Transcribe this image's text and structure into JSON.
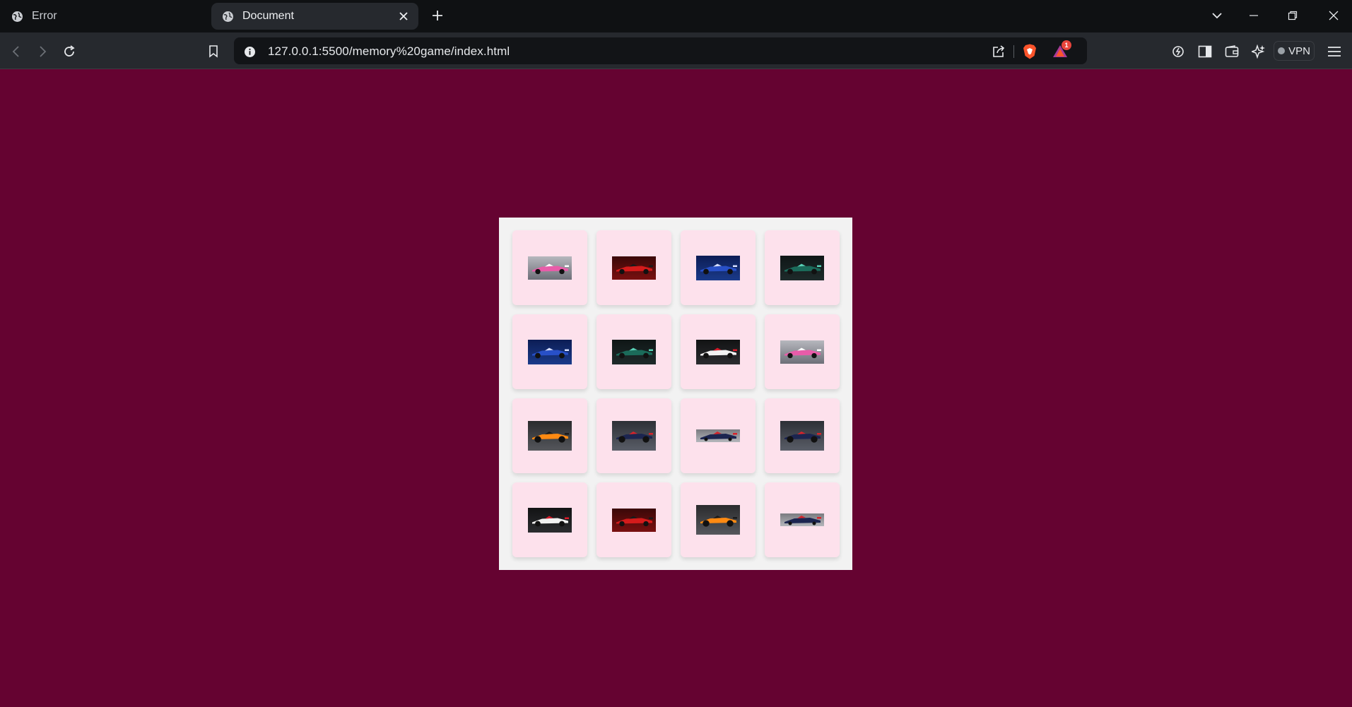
{
  "browser": {
    "tabs": [
      {
        "title": "Error",
        "active": false
      },
      {
        "title": "Document",
        "active": true
      }
    ],
    "url": "127.0.0.1:5500/memory%20game/index.html",
    "notification_count": "1",
    "vpn_label": "VPN"
  },
  "colors": {
    "page_background": "#650331",
    "board_background": "#f2f2f2",
    "card_background": "#fde1ec"
  },
  "game": {
    "cards": [
      {
        "image": "pink-f1-car"
      },
      {
        "image": "red-f1-car"
      },
      {
        "image": "blue-f1-car"
      },
      {
        "image": "green-f1-car"
      },
      {
        "image": "blue-f1-car"
      },
      {
        "image": "green-f1-car"
      },
      {
        "image": "white-f1-car"
      },
      {
        "image": "pink-f1-car"
      },
      {
        "image": "orange-f1-car"
      },
      {
        "image": "navy-f1-car"
      },
      {
        "image": "navy-f1-car-small"
      },
      {
        "image": "navy-f1-car"
      },
      {
        "image": "white-f1-car"
      },
      {
        "image": "red-f1-car"
      },
      {
        "image": "orange-f1-car"
      },
      {
        "image": "navy-f1-car-small"
      }
    ]
  }
}
